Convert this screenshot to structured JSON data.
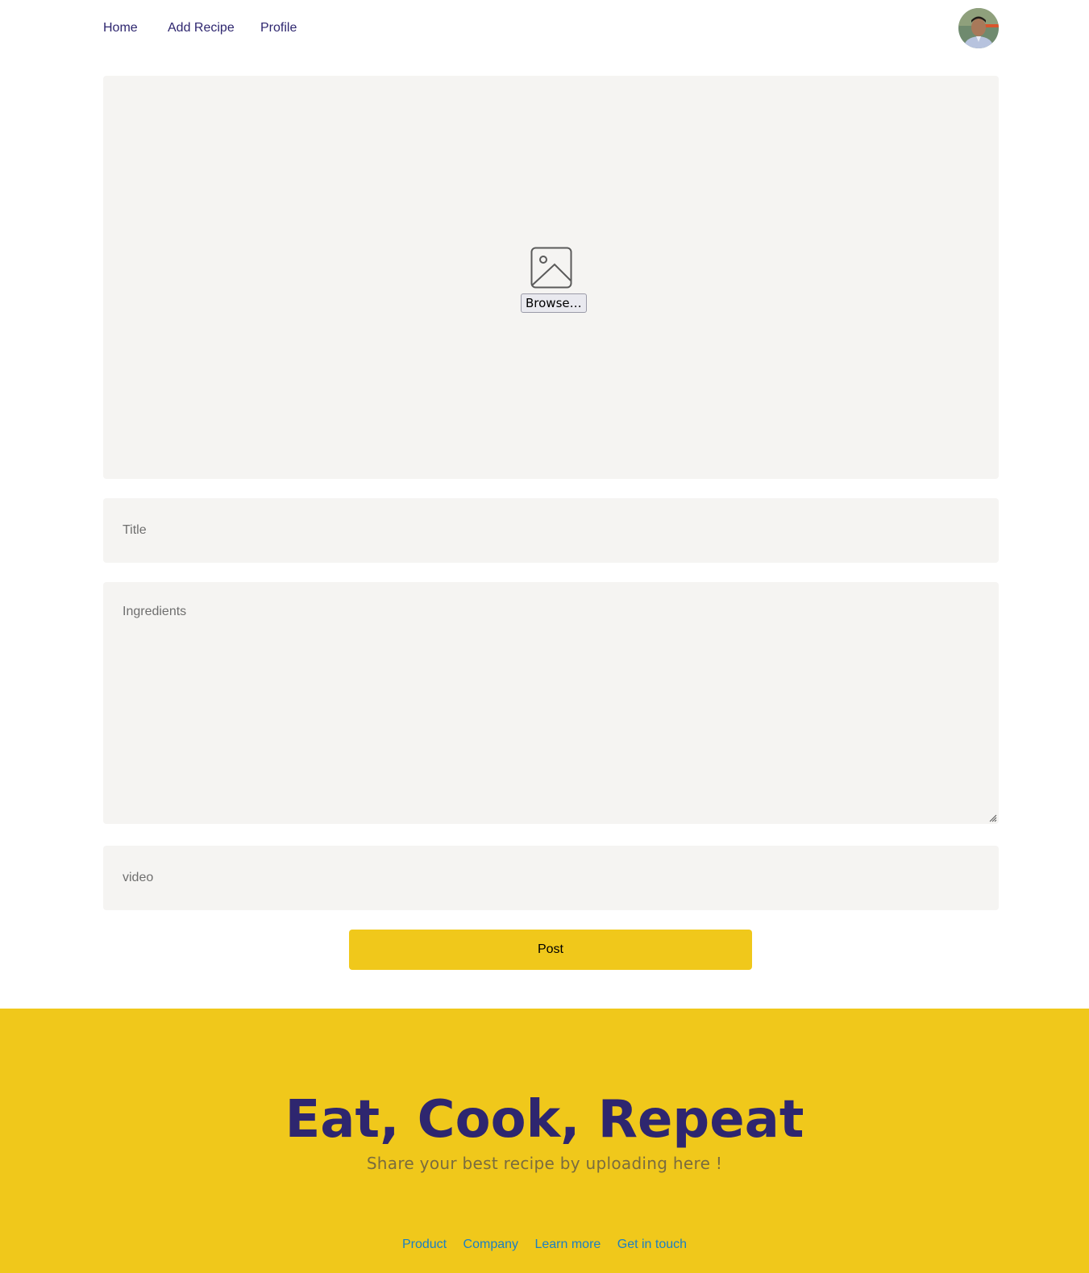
{
  "nav": {
    "home": "Home",
    "add_recipe": "Add Recipe",
    "profile": "Profile"
  },
  "form": {
    "browse_label": "Browse…",
    "title_placeholder": "Title",
    "ingredients_placeholder": "Ingredients",
    "video_placeholder": "video",
    "post_label": "Post"
  },
  "footer": {
    "title": "Eat, Cook, Repeat",
    "subtitle": "Share your best recipe by uploading here !",
    "links": [
      "Product",
      "Company",
      "Learn more",
      "Get in touch"
    ]
  },
  "colors": {
    "accent_yellow": "#f0c81b",
    "nav_text": "#2e266f",
    "field_bg": "#f5f4f2",
    "footer_link": "#1b7fc4"
  }
}
